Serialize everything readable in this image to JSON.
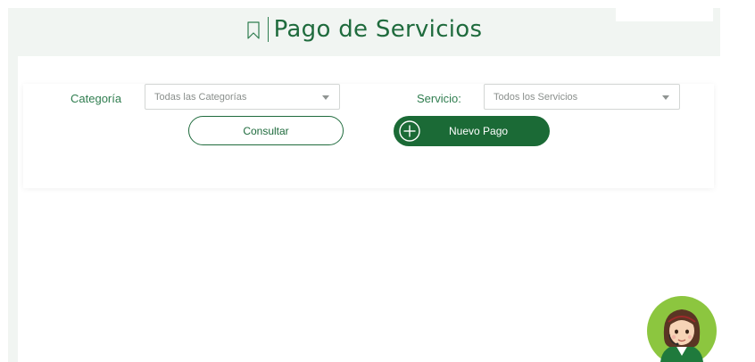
{
  "header": {
    "title": "Pago de Servicios",
    "icon": "bookmark-icon"
  },
  "filters": {
    "category_label": "Categoría",
    "category_value": "Todas las Categorías",
    "service_label": "Servicio:",
    "service_value": "Todos los Servicios"
  },
  "actions": {
    "consult_label": "Consultar",
    "new_payment_label": "Nuevo Pago",
    "new_payment_icon": "plus-circle-icon"
  },
  "assistant": {
    "icon": "assistant-avatar"
  },
  "colors": {
    "brand_green": "#1b6a36",
    "title_green": "#1f6b3d",
    "label_green": "#2f7d4f",
    "frame_bg": "#f1f5f2",
    "avatar_bg": "#8cc63f"
  }
}
